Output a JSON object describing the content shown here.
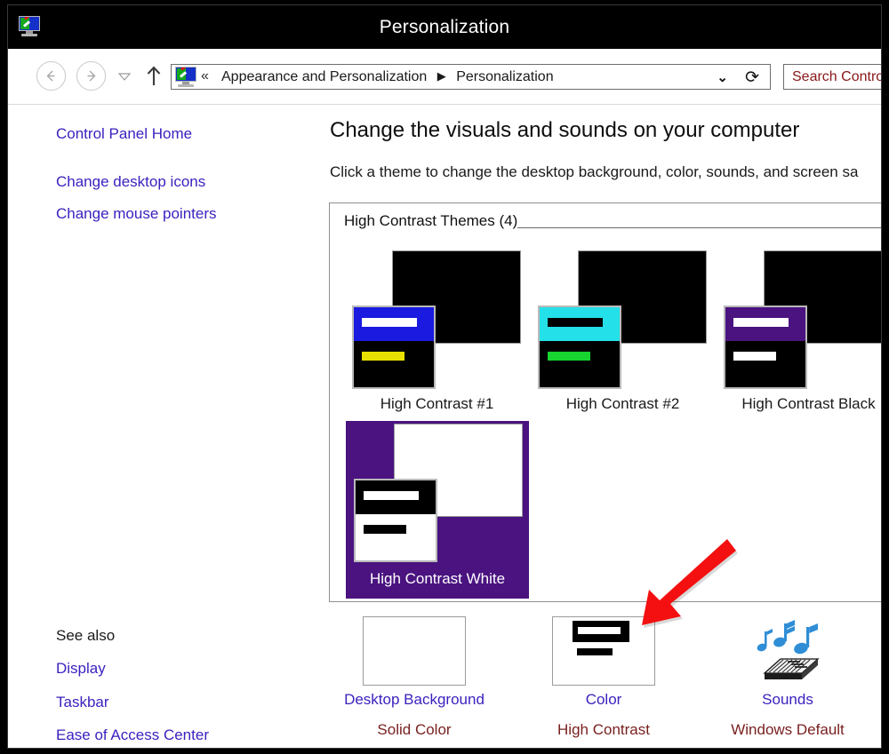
{
  "window": {
    "title": "Personalization",
    "icon": "personalization-monitor-icon"
  },
  "navbar": {
    "back_icon": "back-arrow-icon",
    "forward_icon": "forward-arrow-icon",
    "recent_icon": "recent-locations-chevron-icon",
    "up_icon": "up-arrow-icon",
    "address_icon": "personalization-monitor-icon",
    "chevrons": "«",
    "breadcrumb": [
      "Appearance and Personalization",
      "Personalization"
    ],
    "breadcrumb_separator": "▶",
    "dropdown_icon": "chevron-down-icon",
    "refresh_icon": "refresh-icon",
    "search_placeholder": "Search Control Panel",
    "search_value": ""
  },
  "sidebar": {
    "links": [
      {
        "label": "Control Panel Home"
      },
      {
        "label": "Change desktop icons"
      },
      {
        "label": "Change mouse pointers"
      }
    ],
    "see_also_heading": "See also",
    "see_also_links": [
      {
        "label": "Display"
      },
      {
        "label": "Taskbar"
      },
      {
        "label": "Ease of Access Center"
      }
    ]
  },
  "main": {
    "heading": "Change the visuals and sounds on your computer",
    "subheading": "Click a theme to change the desktop background, color, sounds, and screen sa",
    "group_label": "High Contrast Themes (4)",
    "themes": [
      {
        "name": "High Contrast #1",
        "selected": false,
        "desktop_color": "#000000",
        "window_bg": "#000000",
        "titlebar_color": "#1a1ae0",
        "titlebar_text_color": "#ffffff",
        "body_text_color": "#e8e000"
      },
      {
        "name": "High Contrast #2",
        "selected": false,
        "desktop_color": "#000000",
        "window_bg": "#000000",
        "titlebar_color": "#24e0e8",
        "titlebar_text_color": "#000000",
        "body_text_color": "#17d430"
      },
      {
        "name": "High Contrast Black",
        "selected": false,
        "desktop_color": "#000000",
        "window_bg": "#000000",
        "titlebar_color": "#4a1380",
        "titlebar_text_color": "#ffffff",
        "body_text_color": "#ffffff"
      },
      {
        "name": "High Contrast White",
        "selected": true,
        "desktop_color": "#ffffff",
        "window_bg": "#ffffff",
        "titlebar_color": "#000000",
        "titlebar_text_color": "#ffffff",
        "body_text_color": "#000000"
      }
    ]
  },
  "settings": [
    {
      "label": "Desktop Background",
      "value": "Solid Color",
      "icon": "desktop-background-icon"
    },
    {
      "label": "Color",
      "value": "High Contrast",
      "icon": "window-color-icon"
    },
    {
      "label": "Sounds",
      "value": "Windows Default",
      "icon": "sounds-keyboard-icon"
    }
  ],
  "annotation": {
    "arrow_icon": "red-arrow-pointing-to-color",
    "arrow_color": "#f41010"
  },
  "colors": {
    "link": "#3b22bf",
    "value_text": "#7a2020",
    "selection": "#4a1380",
    "titlebar_bg": "#000000",
    "search_text": "#8a1818"
  }
}
